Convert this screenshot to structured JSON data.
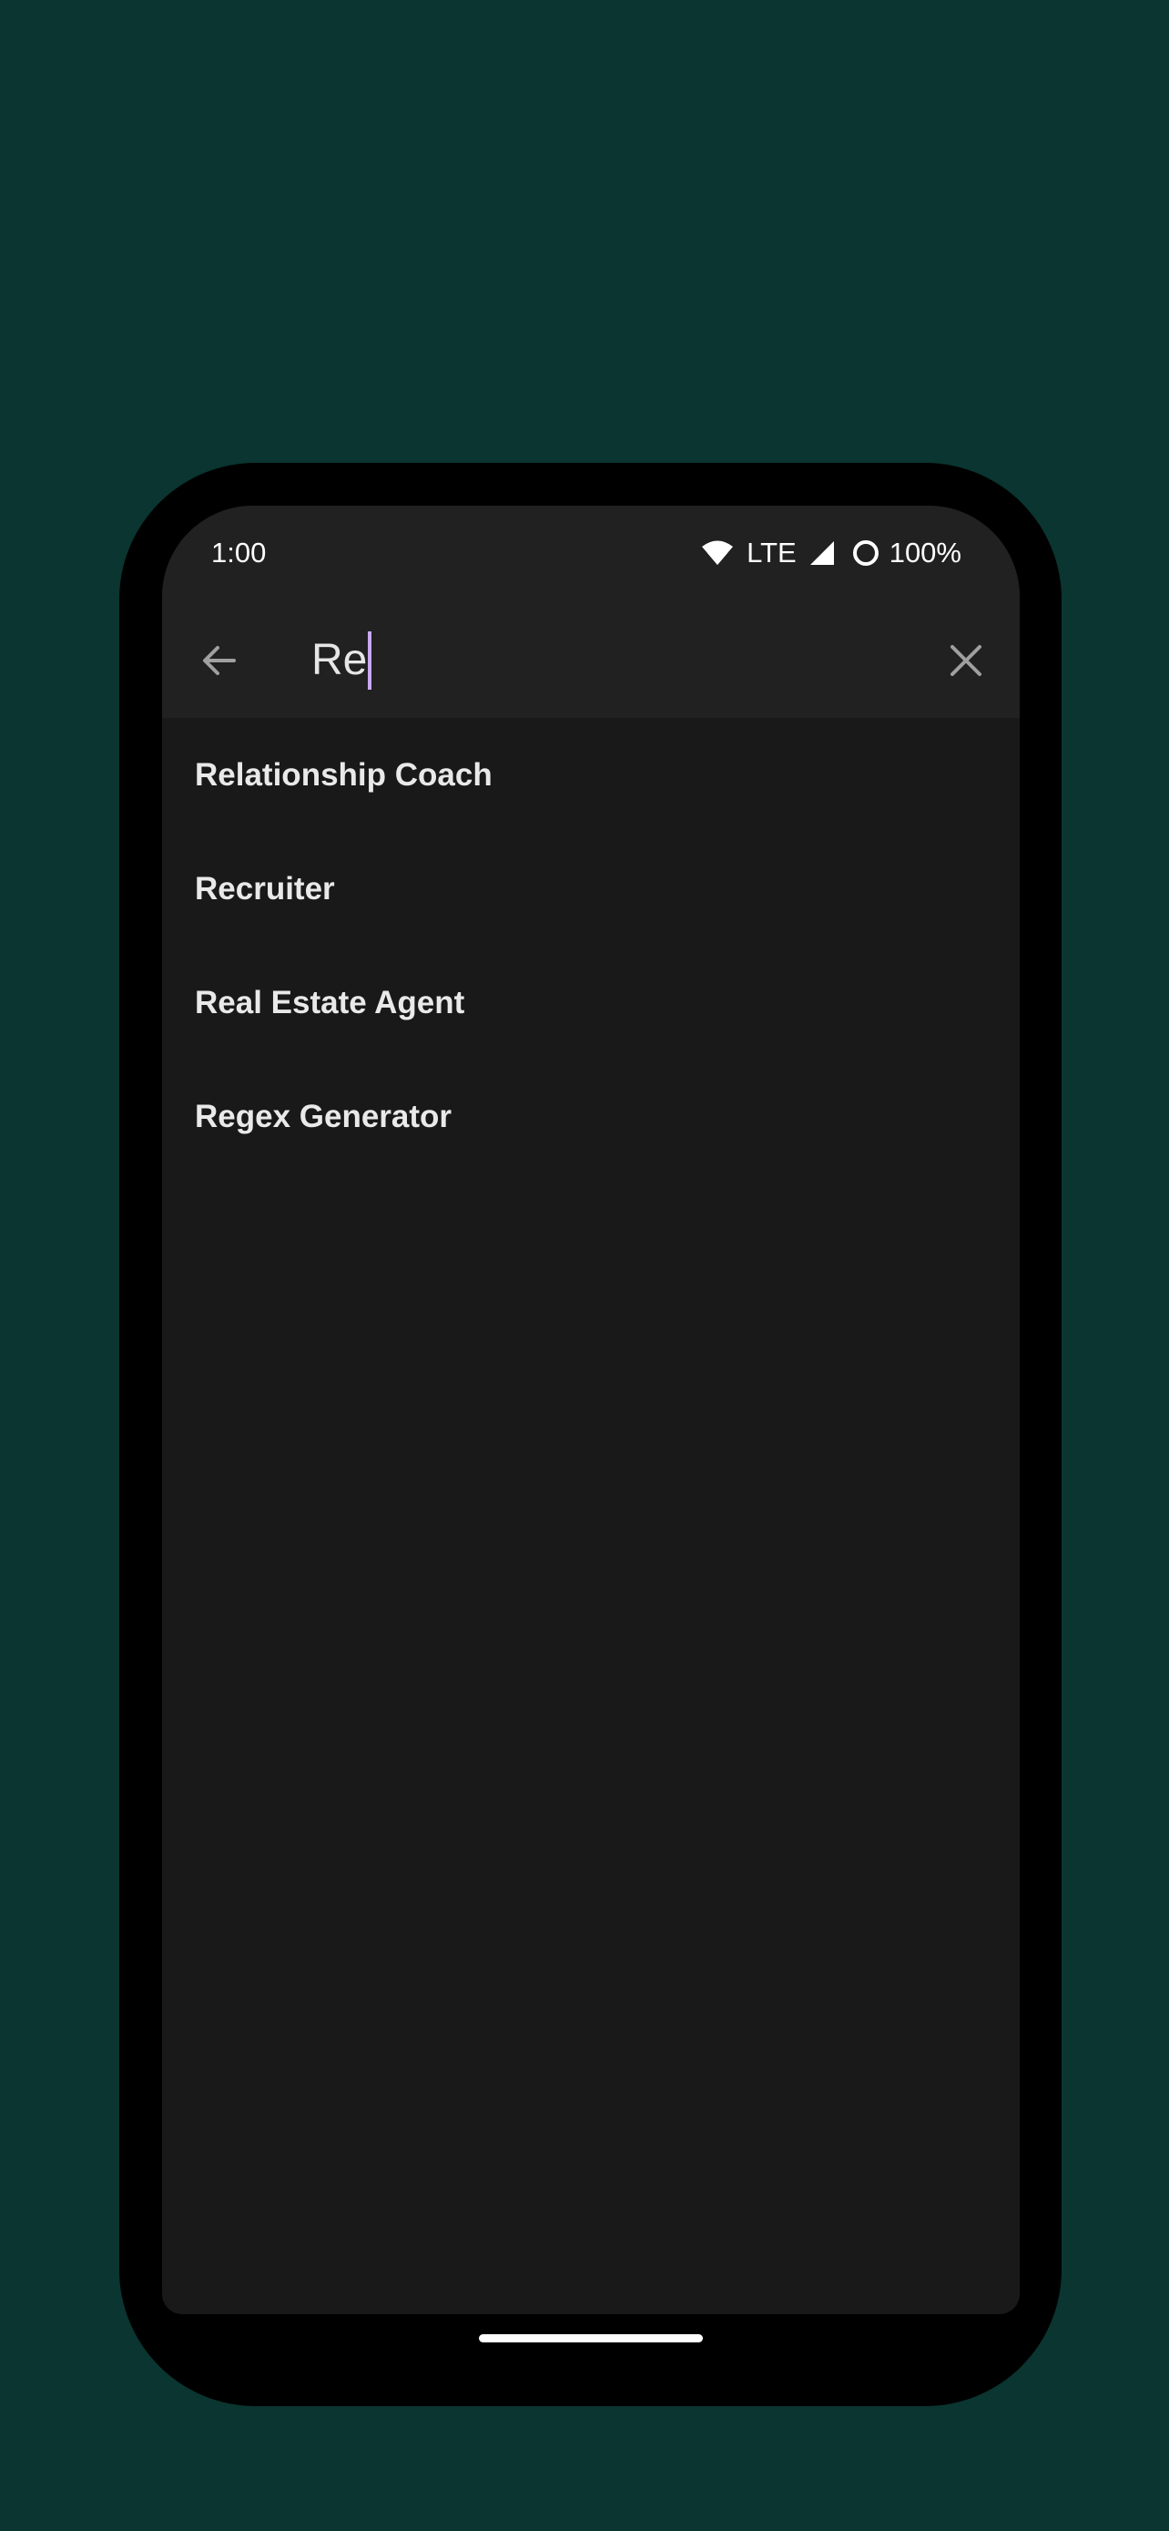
{
  "status_bar": {
    "time": "1:00",
    "network": "LTE",
    "battery": "100%",
    "icons": [
      "wifi-icon",
      "signal-icon",
      "battery-icon"
    ]
  },
  "search": {
    "query": "Re",
    "back_icon": "arrow-back-icon",
    "clear_icon": "close-icon"
  },
  "results": [
    {
      "label": "Relationship Coach"
    },
    {
      "label": "Recruiter"
    },
    {
      "label": "Real Estate Agent"
    },
    {
      "label": "Regex Generator"
    }
  ],
  "colors": {
    "background": "#0a3530",
    "screen": "#191919",
    "top_bar": "#212121",
    "caret": "#c8a8f0"
  }
}
